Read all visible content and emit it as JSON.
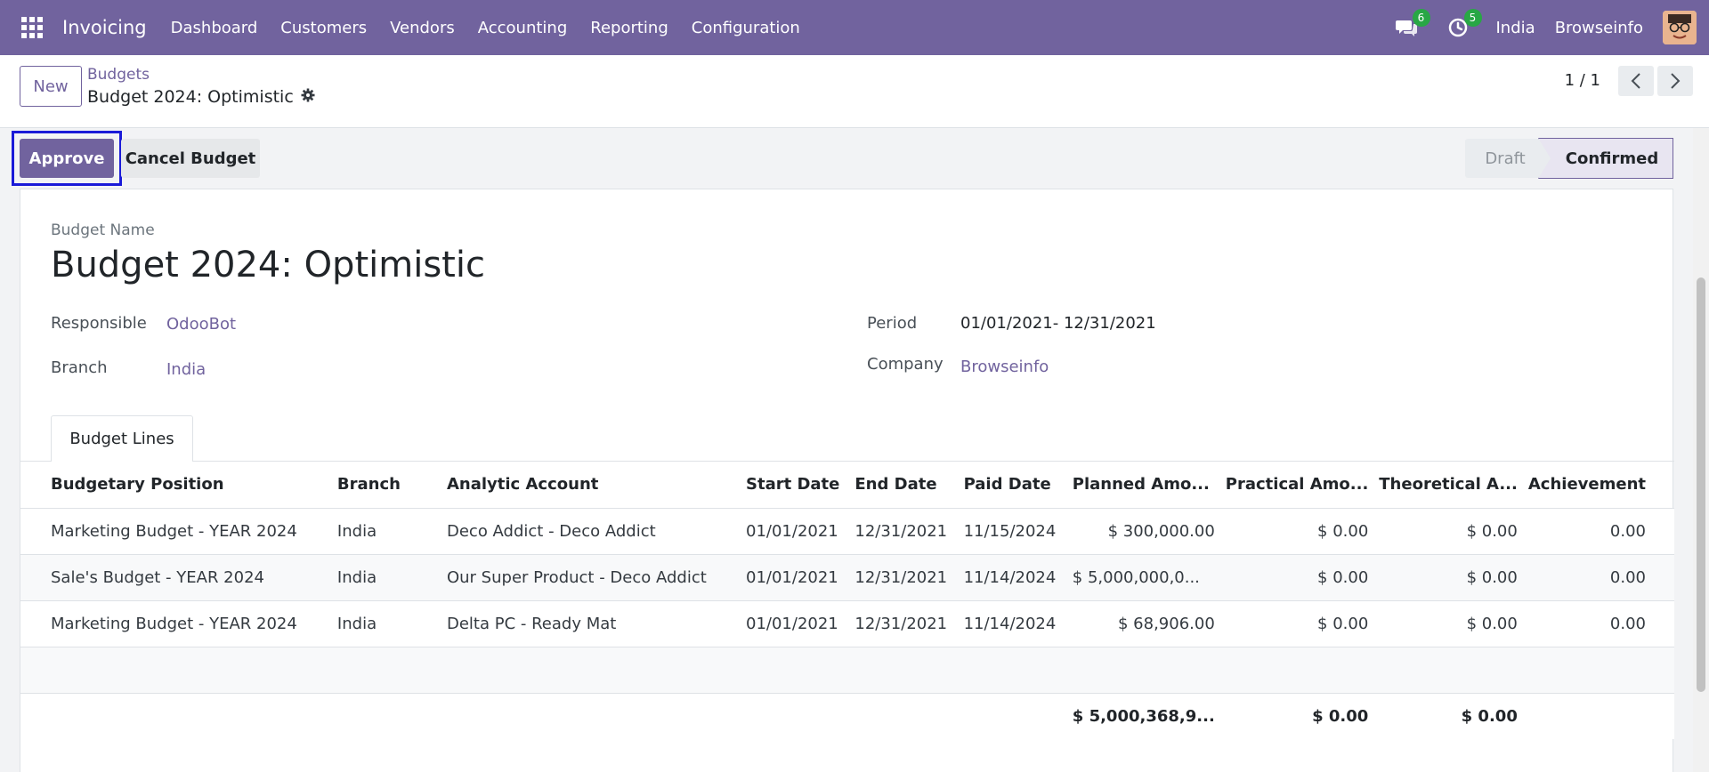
{
  "navbar": {
    "app_name": "Invoicing",
    "menu": [
      "Dashboard",
      "Customers",
      "Vendors",
      "Accounting",
      "Reporting",
      "Configuration"
    ],
    "messages_count": "6",
    "activities_count": "5",
    "branch": "India",
    "company": "Browseinfo",
    "bg_color": "#71639e"
  },
  "control": {
    "new_label": "New",
    "breadcrumb_parent": "Budgets",
    "breadcrumb_current": "Budget 2024: Optimistic",
    "pager": "1 / 1"
  },
  "actions": {
    "approve_label": "Approve",
    "cancel_label": "Cancel Budget"
  },
  "status": {
    "steps": [
      "Draft",
      "Confirmed"
    ],
    "current": "Confirmed"
  },
  "form": {
    "name_label": "Budget Name",
    "name": "Budget 2024: Optimistic",
    "responsible_label": "Responsible",
    "responsible": "OdooBot",
    "branch_label": "Branch",
    "branch": "India",
    "period_label": "Period",
    "period": "01/01/2021- 12/31/2021",
    "company_label": "Company",
    "company": "Browseinfo"
  },
  "tabs": [
    "Budget Lines"
  ],
  "lines": {
    "headers": [
      "Budgetary Position",
      "Branch",
      "Analytic Account",
      "Start Date",
      "End Date",
      "Paid Date",
      "Planned Amo...",
      "Practical Amo...",
      "Theoretical A...",
      "Achievement"
    ],
    "rows": [
      [
        "Marketing Budget - YEAR 2024",
        "India",
        "Deco Addict - Deco Addict",
        "01/01/2021",
        "12/31/2021",
        "11/15/2024",
        "$ 300,000.00",
        "$ 0.00",
        "$ 0.00",
        "0.00"
      ],
      [
        "Sale's Budget - YEAR 2024",
        "India",
        "Our Super Product - Deco Addict",
        "01/01/2021",
        "12/31/2021",
        "11/14/2024",
        "$ 5,000,000,0...",
        "$ 0.00",
        "$ 0.00",
        "0.00"
      ],
      [
        "Marketing Budget - YEAR 2024",
        "India",
        "Delta PC - Ready Mat",
        "01/01/2021",
        "12/31/2021",
        "11/14/2024",
        "$ 68,906.00",
        "$ 0.00",
        "$ 0.00",
        "0.00"
      ]
    ],
    "totals": [
      "$ 5,000,368,9...",
      "$ 0.00",
      "$ 0.00"
    ]
  }
}
